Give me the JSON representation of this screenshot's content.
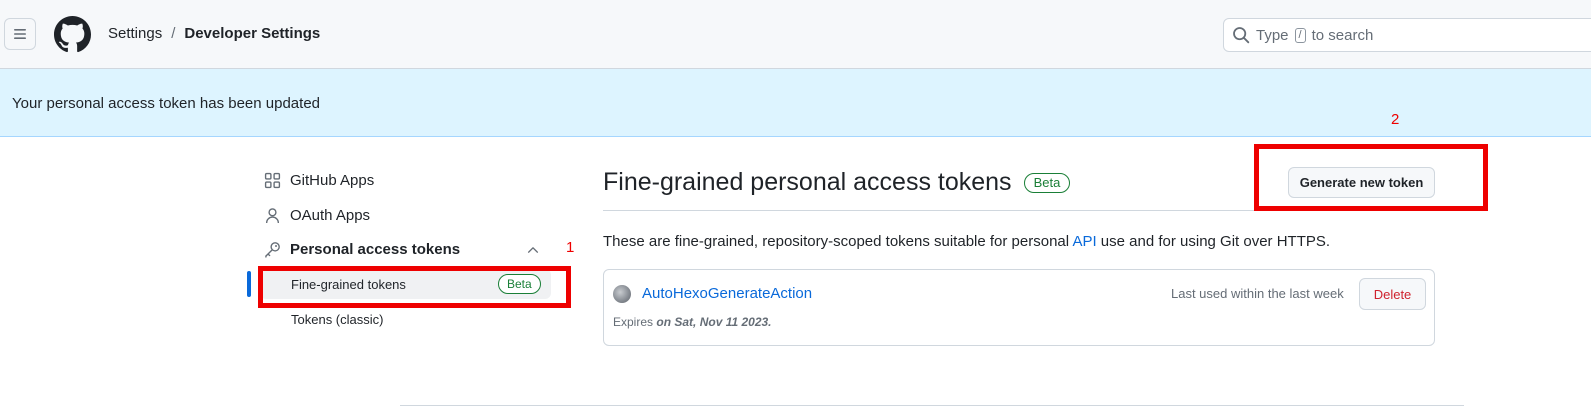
{
  "header": {
    "breadcrumb": {
      "parent": "Settings",
      "separator": "/",
      "current": "Developer Settings"
    },
    "search": {
      "prefix": "Type",
      "key": "/",
      "suffix": "to search"
    }
  },
  "flash": {
    "message": "Your personal access token has been updated"
  },
  "sidebar": {
    "items": [
      {
        "label": "GitHub Apps",
        "icon": "apps-icon"
      },
      {
        "label": "OAuth Apps",
        "icon": "person-icon"
      },
      {
        "label": "Personal access tokens",
        "icon": "key-icon"
      }
    ],
    "subitems": [
      {
        "label": "Fine-grained tokens",
        "badge": "Beta",
        "selected": true
      },
      {
        "label": "Tokens (classic)",
        "selected": false
      }
    ]
  },
  "main": {
    "title": "Fine-grained personal access tokens",
    "title_badge": "Beta",
    "generate_button": "Generate new token",
    "description_before": "These are fine-grained, repository-scoped tokens suitable for personal",
    "description_link": "API",
    "description_after": "use and for using Git over HTTPS.",
    "tokens": [
      {
        "name": "AutoHexoGenerateAction",
        "last_used": "Last used within the last week",
        "delete_label": "Delete",
        "expires_prefix": "Expires",
        "expires_date": "on Sat, Nov 11 2023."
      }
    ]
  },
  "annotations": {
    "marker_1": "1",
    "marker_2": "2",
    "color": "#ee0000"
  },
  "colors": {
    "accent": "#0969da",
    "flash_bg": "#ddf4ff",
    "beta_green": "#1a7f37",
    "danger": "#cf222e"
  }
}
